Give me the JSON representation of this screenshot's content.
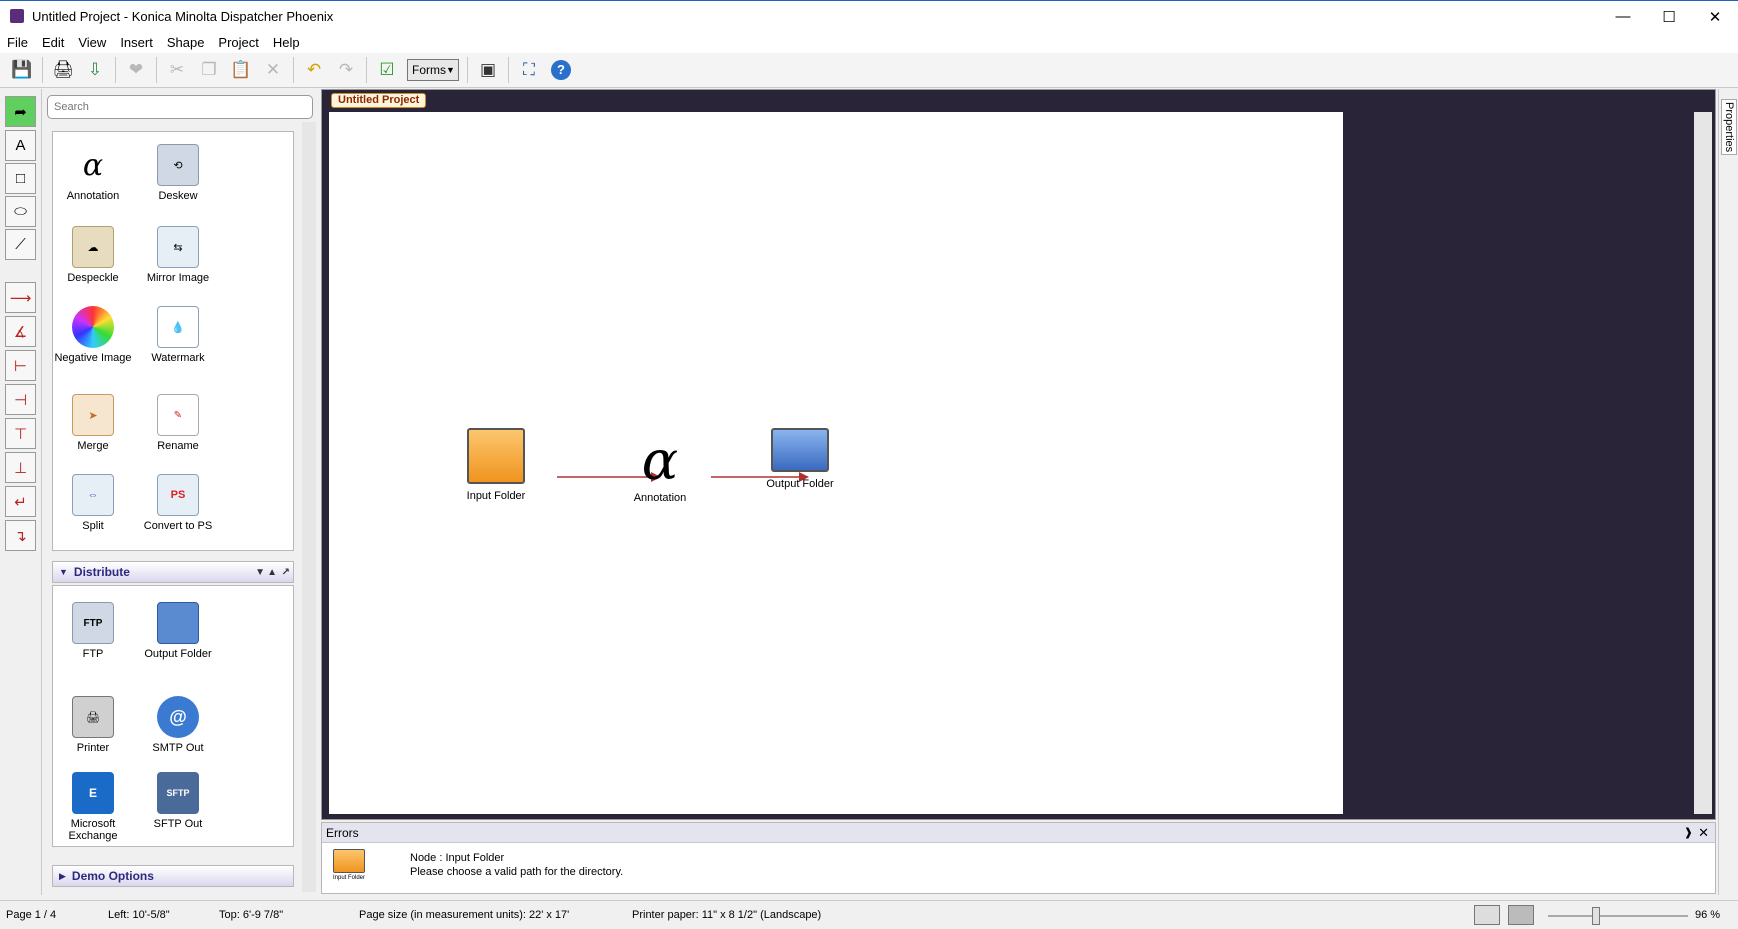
{
  "window": {
    "title": "Untitled Project - Konica Minolta Dispatcher Phoenix"
  },
  "menu": [
    "File",
    "Edit",
    "View",
    "Insert",
    "Shape",
    "Project",
    "Help"
  ],
  "toolbar": {
    "forms_label": "Forms"
  },
  "search": {
    "placeholder": "Search"
  },
  "process_tiles": [
    {
      "label": "Annotation",
      "icon": "annotation-icon"
    },
    {
      "label": "Deskew",
      "icon": "deskew-icon"
    },
    {
      "label": "Despeckle",
      "icon": "despeckle-icon"
    },
    {
      "label": "Mirror Image",
      "icon": "mirror-image-icon"
    },
    {
      "label": "Negative Image",
      "icon": "negative-image-icon"
    },
    {
      "label": "Watermark",
      "icon": "watermark-icon"
    },
    {
      "label": "Merge",
      "icon": "merge-icon"
    },
    {
      "label": "Rename",
      "icon": "rename-icon"
    },
    {
      "label": "Split",
      "icon": "split-icon"
    },
    {
      "label": "Convert to PS",
      "icon": "convert-to-ps-icon"
    }
  ],
  "distribute": {
    "title": "Distribute",
    "tiles": [
      {
        "label": "FTP",
        "icon": "ftp-icon"
      },
      {
        "label": "Output Folder",
        "icon": "output-folder-icon"
      },
      {
        "label": "Printer",
        "icon": "printer-icon"
      },
      {
        "label": "SMTP Out",
        "icon": "smtp-out-icon"
      },
      {
        "label": "Microsoft Exchange",
        "icon": "microsoft-exchange-icon"
      },
      {
        "label": "SFTP Out",
        "icon": "sftp-out-icon"
      }
    ]
  },
  "demo_options": {
    "title": "Demo Options"
  },
  "canvas": {
    "tab_title": "Untitled Project",
    "nodes": [
      {
        "label": "Input Folder"
      },
      {
        "label": "Annotation"
      },
      {
        "label": "Output Folder"
      }
    ]
  },
  "properties_tab": "Properties",
  "errors": {
    "title": "Errors",
    "node_line": "Node : Input Folder",
    "message": "Please choose a valid path for the directory.",
    "thumb_label": "Input Folder"
  },
  "status": {
    "page": "Page 1 / 4",
    "left": "Left:   10'-5/8\"",
    "top": "Top:   6'-9 7/8\"",
    "page_size": "Page size (in measurement units):  22' x 17'",
    "printer_paper": "Printer paper:   11\" x 8 1/2\"  (Landscape)",
    "zoom": "96 %"
  }
}
